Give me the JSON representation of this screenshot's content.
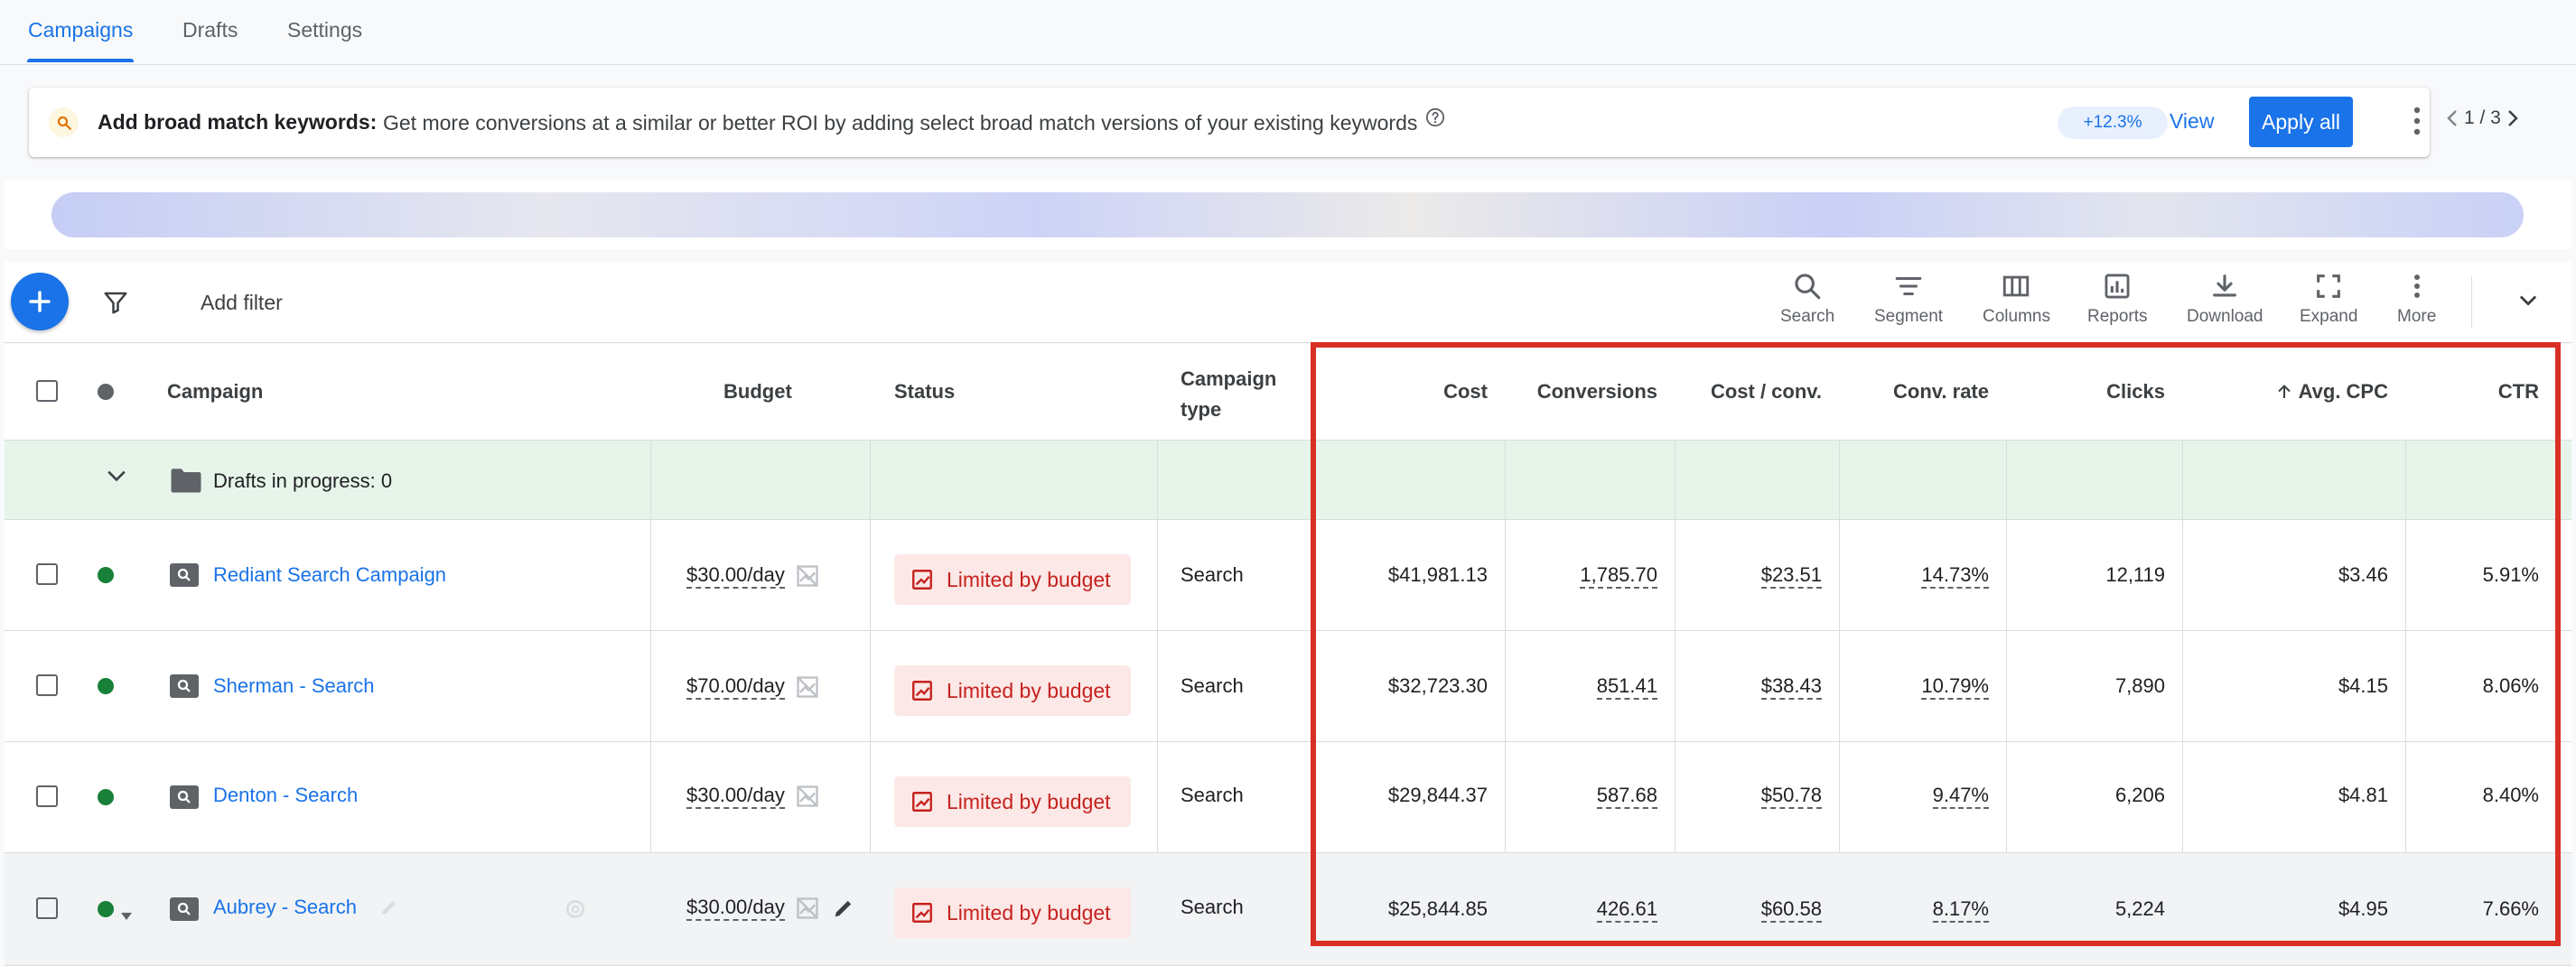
{
  "tabs": [
    {
      "label": "Campaigns"
    },
    {
      "label": "Drafts"
    },
    {
      "label": "Settings"
    }
  ],
  "recommendation": {
    "title": "Add broad match keywords:",
    "text": "Get more conversions at a similar or better ROI by adding select broad match versions of your existing keywords",
    "badge": "+12.3%",
    "view_label": "View",
    "apply_label": "Apply all",
    "pager": "1 / 3"
  },
  "toolbar": {
    "add_filter": "Add filter",
    "buttons": [
      {
        "label": "Search",
        "icon": "search-icon"
      },
      {
        "label": "Segment",
        "icon": "segment-icon"
      },
      {
        "label": "Columns",
        "icon": "columns-icon"
      },
      {
        "label": "Reports",
        "icon": "reports-icon"
      },
      {
        "label": "Download",
        "icon": "download-icon"
      },
      {
        "label": "Expand",
        "icon": "expand-icon"
      },
      {
        "label": "More",
        "icon": "more-vert-icon"
      }
    ]
  },
  "table": {
    "headers": {
      "campaign": "Campaign",
      "budget": "Budget",
      "status": "Status",
      "campaign_type_1": "Campaign",
      "campaign_type_2": "type",
      "cost": "Cost",
      "conversions": "Conversions",
      "cost_per_conv": "Cost / conv.",
      "conv_rate": "Conv. rate",
      "clicks": "Clicks",
      "avg_cpc": "Avg. CPC",
      "ctr": "CTR"
    },
    "drafts_label": "Drafts in progress: 0",
    "rows": [
      {
        "name": "Rediant Search Campaign",
        "budget": "$30.00/day",
        "status": "Limited by budget",
        "type": "Search",
        "cost": "$41,981.13",
        "conversions": "1,785.70",
        "cost_per_conv": "$23.51",
        "conv_rate": "14.73%",
        "clicks": "12,119",
        "avg_cpc": "$3.46",
        "ctr": "5.91%"
      },
      {
        "name": "Sherman - Search",
        "budget": "$70.00/day",
        "status": "Limited by budget",
        "type": "Search",
        "cost": "$32,723.30",
        "conversions": "851.41",
        "cost_per_conv": "$38.43",
        "conv_rate": "10.79%",
        "clicks": "7,890",
        "avg_cpc": "$4.15",
        "ctr": "8.06%"
      },
      {
        "name": "Denton - Search",
        "budget": "$30.00/day",
        "status": "Limited by budget",
        "type": "Search",
        "cost": "$29,844.37",
        "conversions": "587.68",
        "cost_per_conv": "$50.78",
        "conv_rate": "9.47%",
        "clicks": "6,206",
        "avg_cpc": "$4.81",
        "ctr": "8.40%"
      },
      {
        "name": "Aubrey - Search",
        "budget": "$30.00/day",
        "status": "Limited by budget",
        "type": "Search",
        "cost": "$25,844.85",
        "conversions": "426.61",
        "cost_per_conv": "$60.58",
        "conv_rate": "8.17%",
        "clicks": "5,224",
        "avg_cpc": "$4.95",
        "ctr": "7.66%"
      }
    ]
  },
  "colors": {
    "accent": "#1a73e8",
    "enabled_dot": "#188038",
    "status_red": "#c5221f",
    "highlight": "#d93025"
  }
}
